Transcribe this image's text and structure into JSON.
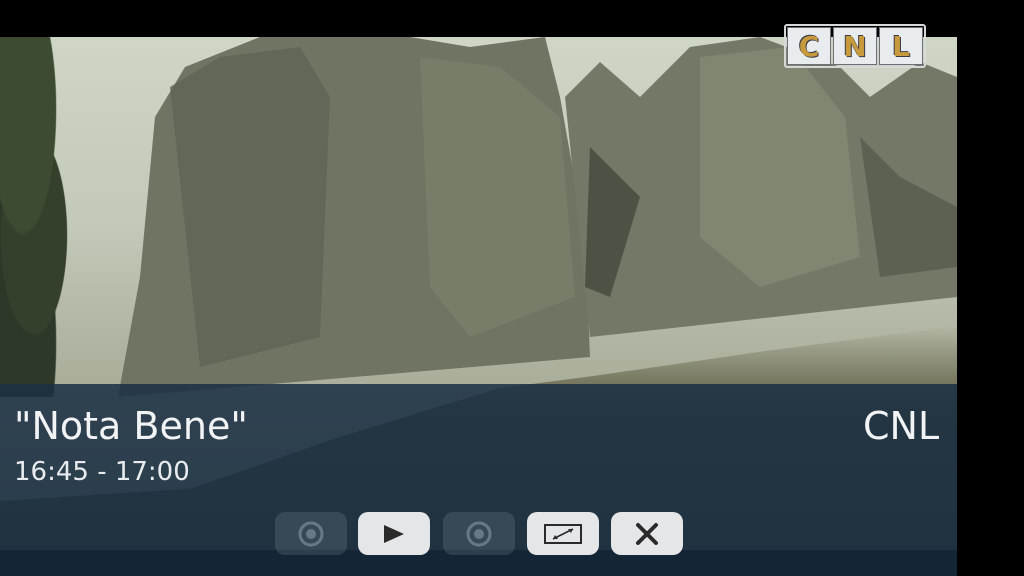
{
  "channel_logo": {
    "letters": [
      "C",
      "N",
      "L"
    ]
  },
  "program": {
    "title": "\"Nota Bene\"",
    "time": "16:45 - 17:00",
    "channel": "CNL"
  },
  "controls": [
    {
      "name": "previous-channel-button",
      "icon": "record-icon",
      "state": "dimmed"
    },
    {
      "name": "play-button",
      "icon": "play-icon",
      "state": "active"
    },
    {
      "name": "next-channel-button",
      "icon": "record-icon",
      "state": "dimmed"
    },
    {
      "name": "aspect-ratio-button",
      "icon": "resize-icon",
      "state": "active"
    },
    {
      "name": "close-button",
      "icon": "close-icon",
      "state": "active"
    }
  ],
  "colors": {
    "panel": "#1b3044",
    "logo_text": "#c89a3e",
    "button_bg": "#e4e6e8"
  }
}
